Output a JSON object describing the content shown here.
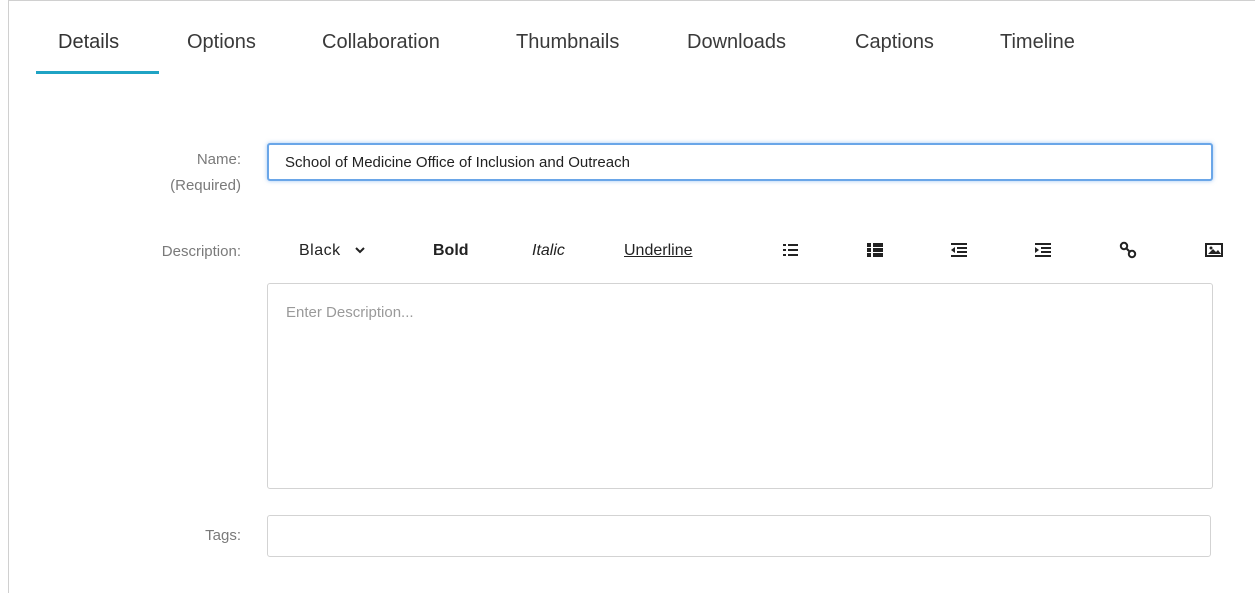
{
  "tabs": [
    {
      "label": "Details",
      "active": true
    },
    {
      "label": "Options",
      "active": false
    },
    {
      "label": "Collaboration",
      "active": false
    },
    {
      "label": "Thumbnails",
      "active": false
    },
    {
      "label": "Downloads",
      "active": false
    },
    {
      "label": "Captions",
      "active": false
    },
    {
      "label": "Timeline",
      "active": false
    }
  ],
  "accent_color": "#1fa3c4",
  "form": {
    "name_label": "Name:",
    "name_required": "(Required)",
    "name_value": "School of Medicine Office of Inclusion and Outreach",
    "description_label": "Description:",
    "description_placeholder": "Enter Description...",
    "tags_label": "Tags:",
    "tags_value": ""
  },
  "toolbar": {
    "color_select": "Black",
    "bold": "Bold",
    "italic": "Italic",
    "underline": "Underline",
    "icons": [
      "ordered-list-icon",
      "unordered-list-icon",
      "outdent-icon",
      "indent-icon",
      "link-icon",
      "image-icon"
    ]
  }
}
